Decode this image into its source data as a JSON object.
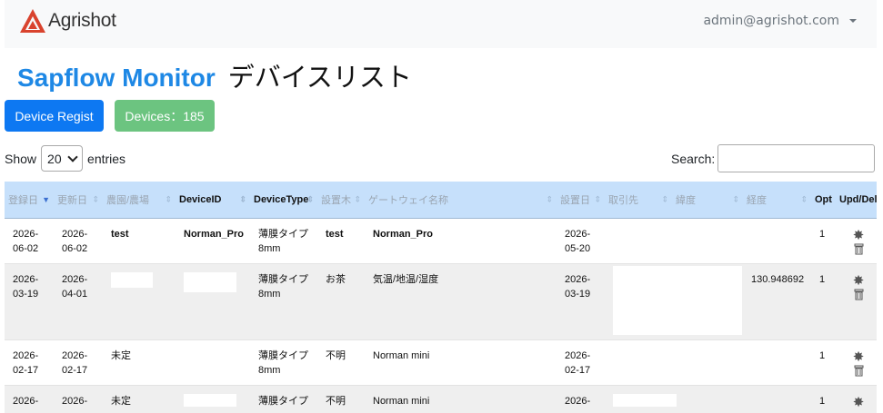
{
  "nav": {
    "brand": "Agrishot",
    "user": "admin@agrishot.com"
  },
  "title": {
    "en": "Sapflow Monitor",
    "jp": "デバイスリスト"
  },
  "buttons": {
    "regist": "Device Regist",
    "devices": "Devices：185"
  },
  "list_controls": {
    "show": "Show",
    "entries_value": "20",
    "entries": "entries",
    "search": "Search:"
  },
  "columns": [
    "登録日",
    "更新日",
    "農園/農場",
    "DeviceID",
    "DeviceType",
    "設置木",
    "ゲートウェイ名称",
    "設置日",
    "取引先",
    "緯度",
    "経度",
    "Opt",
    "Upd/Del"
  ],
  "rows": [
    {
      "reg": "2026-06-02",
      "upd": "2026-06-02",
      "farm": "test",
      "id": "Norman_Pro",
      "type": "薄膜タイプ8mm",
      "tree": "test",
      "gw": "Norman_Pro",
      "set": "2026-05-20",
      "client": "",
      "lat": "",
      "lng": "",
      "opt": "1"
    },
    {
      "reg": "2026-03-19",
      "upd": "2026-04-01",
      "farm": "",
      "id": "",
      "type": "薄膜タイプ8mm",
      "tree": "お茶",
      "gw": "気温/地温/湿度",
      "set": "2026-03-19",
      "client": "",
      "lat": "",
      "lng": "130.948692",
      "opt": "1"
    },
    {
      "reg": "2026-02-17",
      "upd": "2026-02-17",
      "farm": "未定",
      "id": "",
      "type": "薄膜タイプ8mm",
      "tree": "不明",
      "gw": "Norman mini",
      "set": "2026-02-17",
      "client": "",
      "lat": "",
      "lng": "",
      "opt": "1"
    },
    {
      "reg": "2026-",
      "upd": "2026-",
      "farm": "未定",
      "id": "",
      "type": "薄膜タイプ",
      "tree": "不明",
      "gw": "Norman mini",
      "set": "2026-",
      "client": "",
      "lat": "",
      "lng": "",
      "opt": "1"
    }
  ]
}
